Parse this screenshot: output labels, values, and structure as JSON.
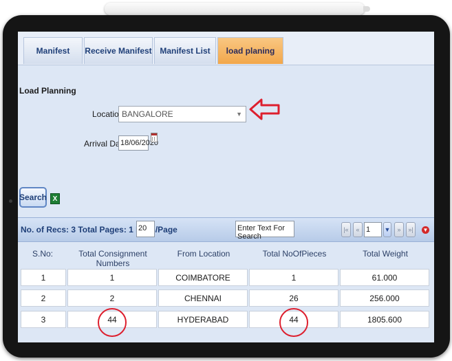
{
  "tabs": [
    {
      "label": "Manifest"
    },
    {
      "label": "Receive Manifest"
    },
    {
      "label": "Manifest List"
    },
    {
      "label": "load planing"
    }
  ],
  "section_title": "Load Planning",
  "location": {
    "label": "Location :",
    "value": "BANGALORE"
  },
  "arrival_date": {
    "label": "Arrival Date :",
    "value": "18/06/2020"
  },
  "search_label": "Search",
  "excel_icon": "excel-export-icon",
  "pager": {
    "recs_text": "No. of Recs: 3  Total Pages: 1  Recs/Page",
    "recs_per_page": "20",
    "search_placeholder": "Enter Text For Search",
    "page_value": "1"
  },
  "table": {
    "headers": [
      "S.No:",
      "Total Consignment Numbers",
      "From Location",
      "Total NoOfPieces",
      "Total Weight"
    ],
    "rows": [
      [
        "1",
        "1",
        "COIMBATORE",
        "1",
        "61.000"
      ],
      [
        "2",
        "2",
        "CHENNAI",
        "26",
        "256.000"
      ],
      [
        "3",
        "44",
        "HYDERABAD",
        "44",
        "1805.600"
      ]
    ]
  },
  "colors": {
    "active_tab": "#f2a74b",
    "header_text": "#1f3f78",
    "annotation_red": "#dd1f2e"
  }
}
